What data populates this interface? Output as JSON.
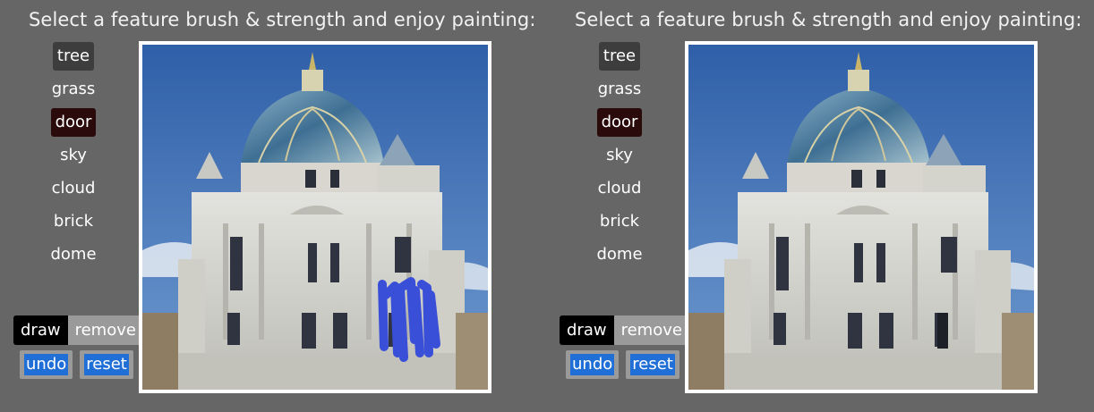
{
  "left_panel": {
    "title": "Select a feature brush & strength and enjoy painting:",
    "features": [
      "tree",
      "grass",
      "door",
      "sky",
      "cloud",
      "brick",
      "dome"
    ],
    "modes": {
      "draw": "draw",
      "remove": "remove"
    },
    "actions": {
      "undo": "undo",
      "reset": "reset"
    }
  },
  "right_panel": {
    "title": "Select a feature brush & strength and enjoy painting:",
    "features": [
      "tree",
      "grass",
      "door",
      "sky",
      "cloud",
      "brick",
      "dome"
    ],
    "modes": {
      "draw": "draw",
      "remove": "remove"
    },
    "actions": {
      "undo": "undo",
      "reset": "reset"
    }
  },
  "colors": {
    "background": "#666666",
    "selected_tree": "#3d3d3d",
    "selected_door": "#2a0a0a",
    "draw_active": "#000000",
    "remove_inactive": "#9a9a9a",
    "action_blue": "#1f6fd6",
    "paint_stroke": "#3a4fd8",
    "sky": "#3f6fb3"
  }
}
